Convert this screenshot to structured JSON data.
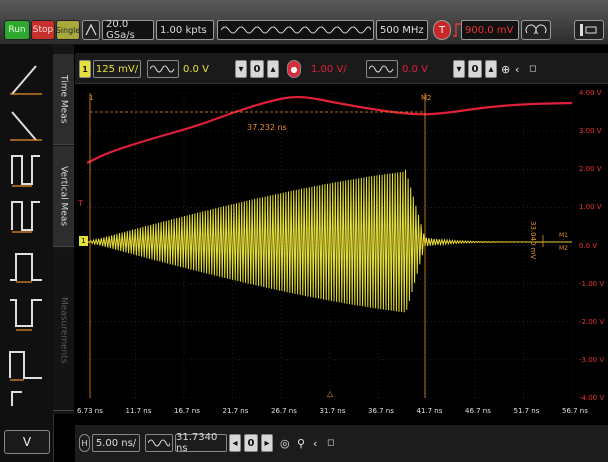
{
  "toolbar": {
    "run_label": "Run",
    "stop_label": "Stop",
    "single_label": "Single",
    "sample_rate": "20.0 GSa/s",
    "record_length": "1.00 kpts",
    "bandwidth": "500 MHz",
    "trigger_level": "900.0 mV"
  },
  "channel1": {
    "number": "1",
    "scale": "125 mV/",
    "offset": "0.0 V"
  },
  "channel4": {
    "scale": "1.00 V/",
    "offset": "0.0 V"
  },
  "tabs": {
    "time_meas": "Time Meas",
    "vertical_meas": "Vertical Meas",
    "measurements": "Measurements"
  },
  "timebase": {
    "scale": "5.00 ns/",
    "position": "31.7340 ns",
    "h_label": "H"
  },
  "waveform": {
    "trigger_marker": "T",
    "ground_marker": "1",
    "marker1": "1",
    "marker2": "M2",
    "time_measurement": "37.232 ns",
    "amplitude_measurement": "33.040 mV",
    "m_label1": "M1",
    "m_label2": "M2"
  },
  "right_axis": [
    "4.00 V",
    "3.00 V",
    "2.00 V",
    "1.00 V",
    "0.0 V",
    "-1.00 V",
    "-2.00 V",
    "-3.00 V",
    "-4.00 V"
  ],
  "bottom_axis": [
    "6.73 ns",
    "11.7 ns",
    "16.7 ns",
    "21.7 ns",
    "26.7 ns",
    "31.7 ns",
    "36.7 ns",
    "41.7 ns",
    "46.7 ns",
    "51.7 ns",
    "56.7 ns"
  ],
  "left_panel": {
    "expand_label": "V"
  },
  "colors": {
    "channel1": "#e6e03a",
    "channel4": "#e0203a",
    "marker": "#e8902a",
    "grid": "#555555"
  }
}
